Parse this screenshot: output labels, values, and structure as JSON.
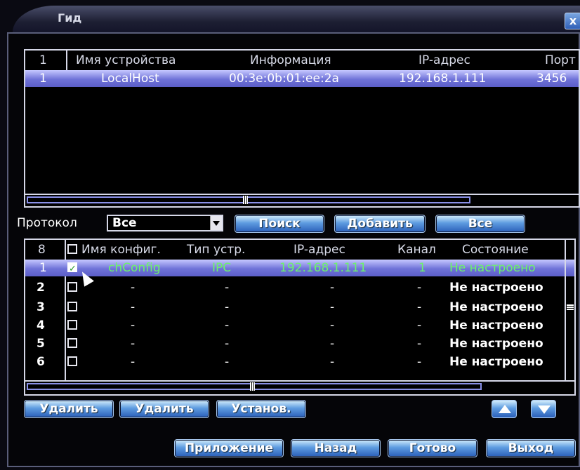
{
  "window": {
    "title": "Гид",
    "close_glyph": "x"
  },
  "devices": {
    "headers": {
      "num": "1",
      "name": "Имя устройства",
      "info": "Информация",
      "ip": "IP-адрес",
      "port": "Порт"
    },
    "rows": [
      {
        "num": "1",
        "name": "LocalHost",
        "info": "00:3e:0b:01:ee:2a",
        "ip": "192.168.1.111",
        "port": "3456"
      }
    ]
  },
  "controls": {
    "protocol_label": "Протокол",
    "protocol_value": "Все",
    "search": "Поиск",
    "add": "Добавить",
    "all": "Все"
  },
  "channels": {
    "headers": {
      "count": "8",
      "name": "Имя конфиг.",
      "type": "Тип устр.",
      "ip": "IP-адрес",
      "channel": "Канал",
      "status": "Состояние"
    },
    "rows": [
      {
        "num": "1",
        "checked": true,
        "name": "chConfig",
        "type": "IPC",
        "ip": "192.168.1.111",
        "channel": "1",
        "status": "Не настроено"
      },
      {
        "num": "2",
        "checked": false,
        "name": "-",
        "type": "-",
        "ip": "-",
        "channel": "-",
        "status": "Не настроено"
      },
      {
        "num": "3",
        "checked": false,
        "name": "-",
        "type": "-",
        "ip": "-",
        "channel": "-",
        "status": "Не настроено"
      },
      {
        "num": "4",
        "checked": false,
        "name": "-",
        "type": "-",
        "ip": "-",
        "channel": "-",
        "status": "Не настроено"
      },
      {
        "num": "5",
        "checked": false,
        "name": "-",
        "type": "-",
        "ip": "-",
        "channel": "-",
        "status": "Не настроено"
      },
      {
        "num": "6",
        "checked": false,
        "name": "-",
        "type": "-",
        "ip": "-",
        "channel": "-",
        "status": "Не настроено"
      }
    ]
  },
  "actions": {
    "delete1": "Удалить",
    "delete2": "Удалить",
    "install": "Установ.",
    "apply": "Приложение",
    "back": "Назад",
    "done": "Готово",
    "exit": "Выход"
  },
  "colors": {
    "selection": "#6f72d8",
    "active_text": "#6cf26c",
    "button": "#5e9ce0"
  }
}
